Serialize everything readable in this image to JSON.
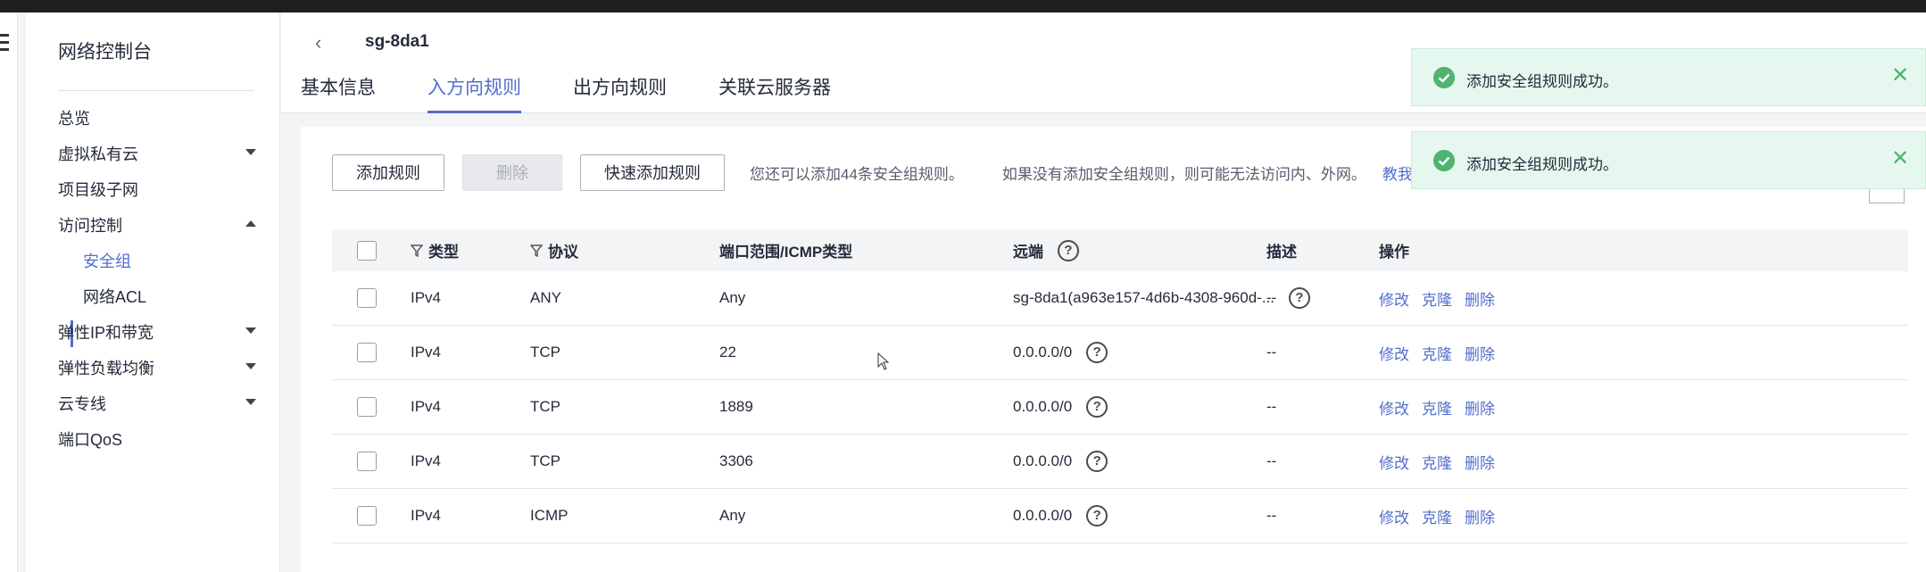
{
  "sidebar": {
    "title": "网络控制台",
    "items": [
      {
        "label": "总览"
      },
      {
        "label": "虚拟私有云"
      },
      {
        "label": "项目级子网"
      },
      {
        "label": "访问控制"
      },
      {
        "label": "安全组"
      },
      {
        "label": "网络ACL"
      },
      {
        "label": "弹性IP和带宽"
      },
      {
        "label": "弹性负载均衡"
      },
      {
        "label": "云专线"
      },
      {
        "label": "端口QoS"
      }
    ]
  },
  "header": {
    "back_glyph": "‹",
    "sg_name": "sg-8da1",
    "tabs": [
      {
        "label": "基本信息"
      },
      {
        "label": "入方向规则"
      },
      {
        "label": "出方向规则"
      },
      {
        "label": "关联云服务器"
      }
    ]
  },
  "toolbar": {
    "add_rule": "添加规则",
    "delete": "删除",
    "quick_add": "快速添加规则",
    "tip_quota": "您还可以添加44条安全组规则。",
    "tip_warning": "如果没有添加安全组规则，则可能无法访问内、外网。",
    "tip_link": "教我设置"
  },
  "table": {
    "columns": {
      "type": "类型",
      "protocol": "协议",
      "port": "端口范围/ICMP类型",
      "remote": "远端",
      "description": "描述",
      "actions": "操作"
    },
    "help_glyph": "?",
    "action_labels": {
      "modify": "修改",
      "clone": "克隆",
      "delete": "删除"
    },
    "rows": [
      {
        "type": "IPv4",
        "protocol": "ANY",
        "port": "Any",
        "remote": "sg-8da1(a963e157-4d6b-4308-960d-...",
        "description": "--"
      },
      {
        "type": "IPv4",
        "protocol": "TCP",
        "port": "22",
        "remote": "0.0.0.0/0",
        "description": "--"
      },
      {
        "type": "IPv4",
        "protocol": "TCP",
        "port": "1889",
        "remote": "0.0.0.0/0",
        "description": "--"
      },
      {
        "type": "IPv4",
        "protocol": "TCP",
        "port": "3306",
        "remote": "0.0.0.0/0",
        "description": "--"
      },
      {
        "type": "IPv4",
        "protocol": "ICMP",
        "port": "Any",
        "remote": "0.0.0.0/0",
        "description": "--"
      }
    ]
  },
  "toasts": [
    {
      "message": "添加安全组规则成功。",
      "close": "✕"
    },
    {
      "message": "添加安全组规则成功。",
      "close": "✕"
    }
  ],
  "colors": {
    "accent": "#526ecc",
    "success": "#50b371"
  }
}
